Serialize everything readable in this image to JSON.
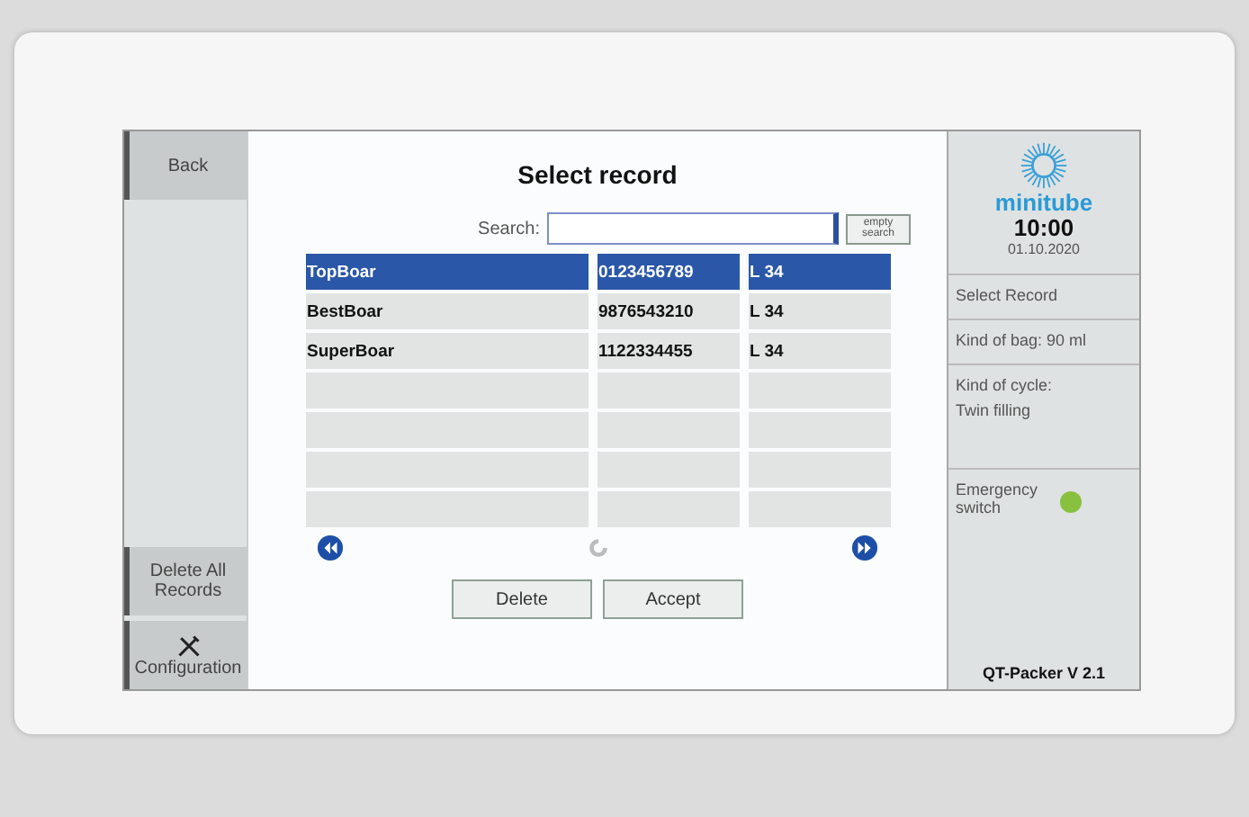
{
  "sidebar": {
    "items": [
      {
        "label": "Back",
        "kind": "text"
      },
      {
        "label": "Delete All Records",
        "kind": "text"
      },
      {
        "label": "Configuration",
        "kind": "tool"
      }
    ]
  },
  "title": "Select record",
  "search": {
    "label": "Search:",
    "clear_button": "empty search"
  },
  "table": {
    "rows": [
      {
        "cells": [
          "TopBoar",
          "0123456789",
          "L 34"
        ],
        "selected": true
      },
      {
        "cells": [
          "BestBoar",
          "9876543210",
          "L 34"
        ],
        "selected": false
      },
      {
        "cells": [
          "SuperBoar",
          "1122334455",
          "L 34"
        ],
        "selected": false
      },
      {
        "cells": [
          "",
          "",
          ""
        ],
        "selected": false
      },
      {
        "cells": [
          "",
          "",
          ""
        ],
        "selected": false
      },
      {
        "cells": [
          "",
          "",
          ""
        ],
        "selected": false
      },
      {
        "cells": [
          "",
          "",
          ""
        ],
        "selected": false
      }
    ]
  },
  "buttons": [
    "Delete",
    "Accept"
  ],
  "status_panel": {
    "brand": "minitube",
    "time": "10:00",
    "date": "01.10.2020",
    "items": [
      "Select Record",
      "Kind of bag: 90 ml"
    ],
    "cycle_label": "Kind of cycle:",
    "cycle_value": "Twin filling",
    "emergency": {
      "label": "Emergency switch",
      "color": "#88c040"
    },
    "version": "QT-Packer V 2.1"
  }
}
